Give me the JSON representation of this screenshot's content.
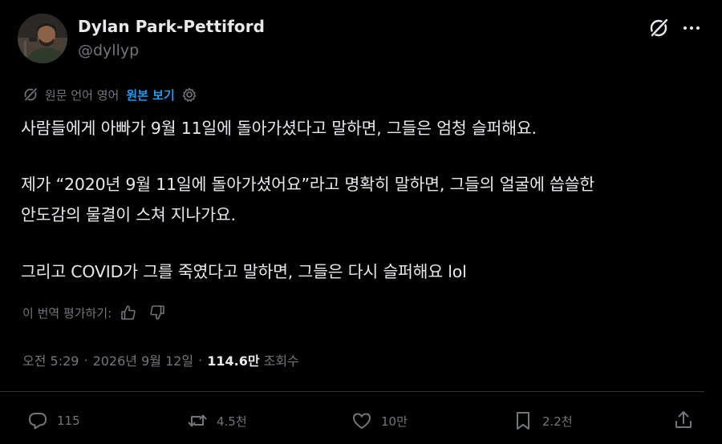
{
  "author": {
    "name": "Dylan Park-Pettiford",
    "handle": "@dyllyp"
  },
  "translation": {
    "label": "원문 언어 영어",
    "show_original": "원본 보기"
  },
  "tweet": {
    "lines": [
      "사람들에게 아빠가 9월 11일에 돌아가셨다고 말하면, 그들은 엄청 슬퍼해요.",
      "제가 “2020년 9월 11일에 돌아가셨어요”라고 명확히 말하면, 그들의 얼굴에 씁쓸한",
      "안도감의 물결이 스쳐 지나가요.",
      "그리고 COVID가 그를 죽였다고 말하면, 그들은 다시 슬퍼해요 lol"
    ]
  },
  "rating": {
    "label": "이 번역 평가하기:"
  },
  "meta": {
    "time": "오전 5:29",
    "date": "2026년 9월 12일",
    "views_count": "114.6만",
    "views_label": "조회수",
    "separator": "·"
  },
  "actions": {
    "replies": "115",
    "reposts": "4.5천",
    "likes": "10만",
    "bookmarks": "2.2천"
  },
  "icons": {
    "grok": "grok-icon",
    "more": "more-icon",
    "translate": "translate-icon",
    "settings": "gear-icon",
    "thumbs_up": "thumbs-up-icon",
    "thumbs_down": "thumbs-down-icon",
    "reply": "reply-icon",
    "repost": "repost-icon",
    "like": "heart-icon",
    "bookmark": "bookmark-icon",
    "share": "share-icon"
  },
  "colors": {
    "background": "#000000",
    "text": "#e7e9ea",
    "secondary": "#71767b",
    "link": "#1d9bf0",
    "divider": "#2f3336"
  }
}
